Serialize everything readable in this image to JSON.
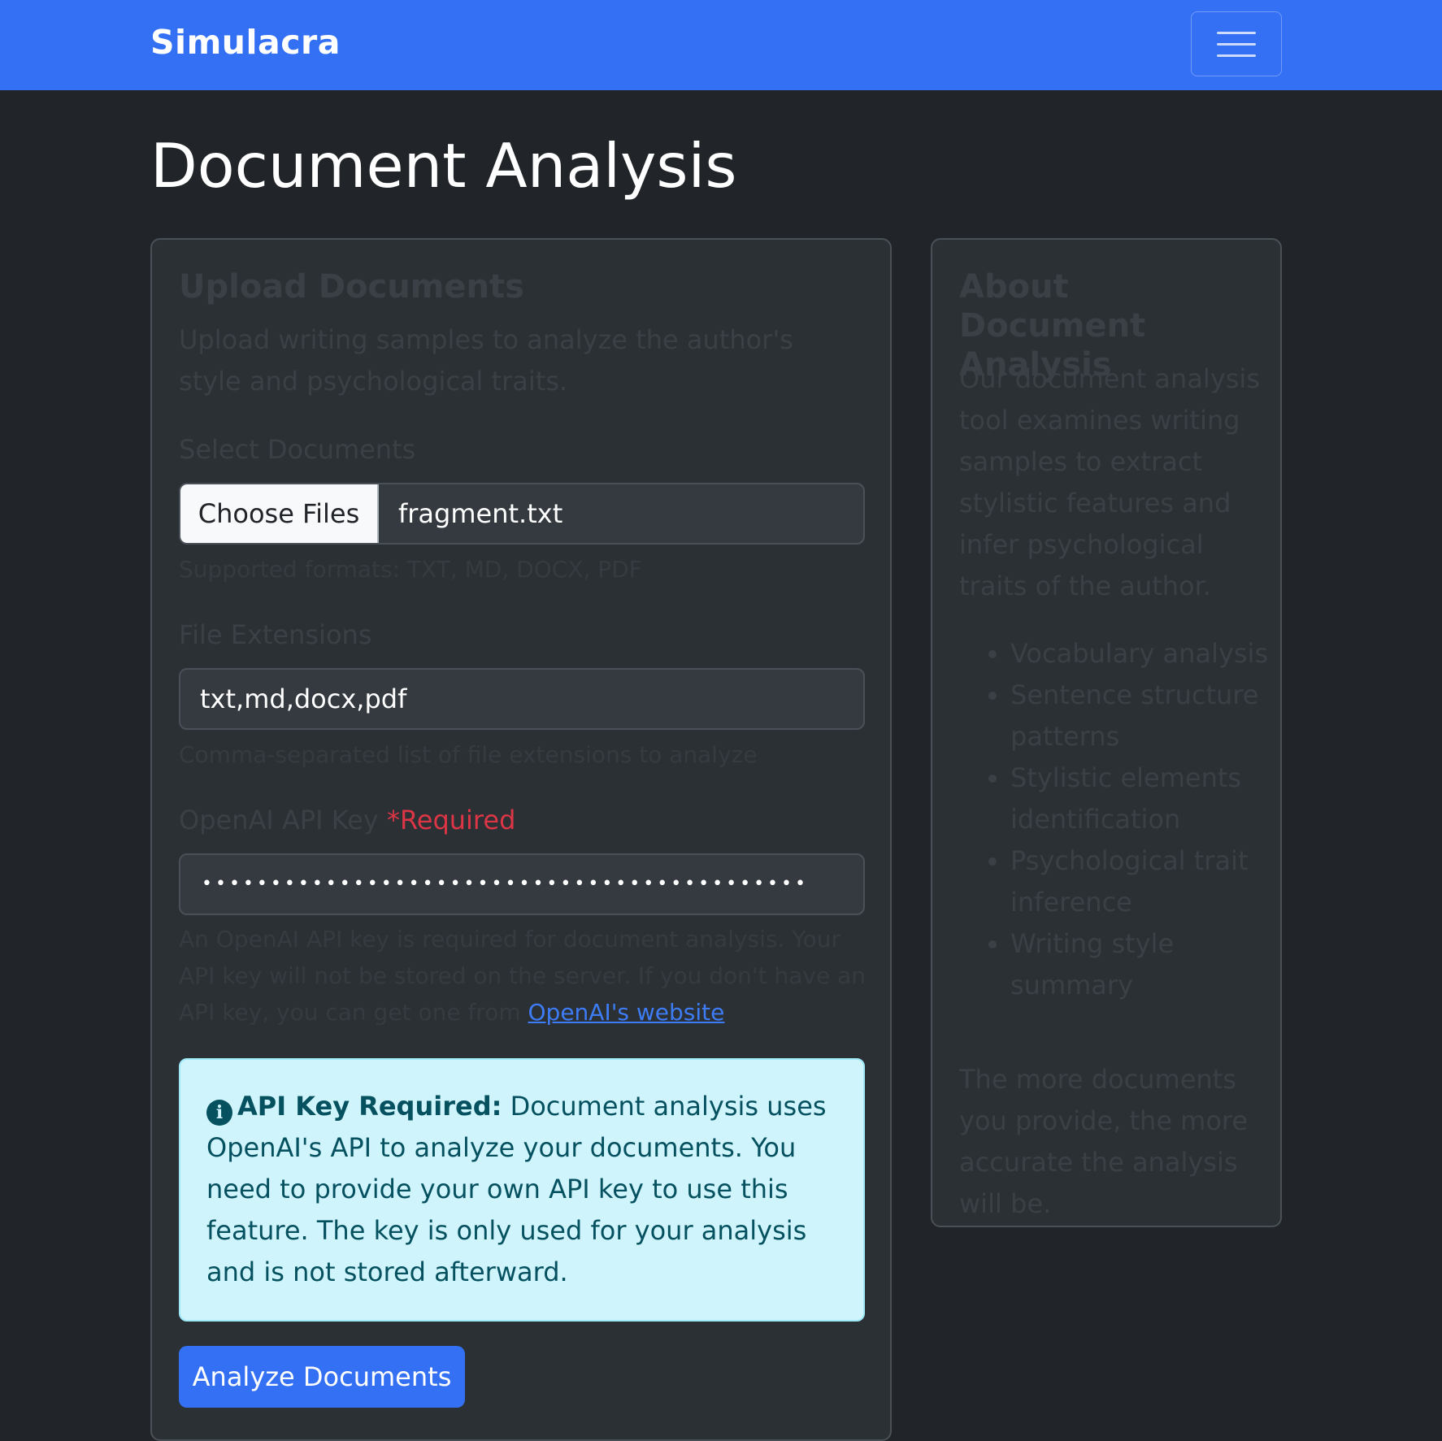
{
  "navbar": {
    "brand": "Simulacra",
    "menu_icon": "hamburger-menu-icon"
  },
  "page": {
    "title": "Document Analysis"
  },
  "upload_card": {
    "title": "Upload Documents",
    "description": "Upload writing samples to analyze the author's style and psychological traits.",
    "select_label": "Select Documents",
    "choose_button": "Choose Files",
    "selected_file": "fragment.txt",
    "formats_help": "Supported formats: TXT, MD, DOCX, PDF",
    "extensions_label": "File Extensions",
    "extensions_value": "txt,md,docx,pdf",
    "extensions_help": "Comma-separated list of file extensions to analyze",
    "api_key_label": "OpenAI API Key",
    "api_key_required": "*Required",
    "api_key_masked": "••••••••••••••••••••••••••••••••••••••••••••",
    "api_key_help": "An OpenAI API key is required for document analysis. Your API key will not be stored on the server. If you don't have an API key, you can get one from",
    "api_key_link": "OpenAI's website",
    "alert_icon": "info-circle-icon",
    "alert_title": "API Key Required:",
    "alert_text": "Document analysis uses OpenAI's API to analyze your documents. You need to provide your own API key to use this feature. The key is only used for your analysis and is not stored afterward.",
    "submit_button": "Analyze Documents"
  },
  "about_card": {
    "title": "About Document Analysis",
    "description": "Our document analysis tool examines writing samples to extract stylistic features and infer psychological traits of the author.",
    "features": [
      "Vocabulary analysis",
      "Sentence structure patterns",
      "Stylistic elements identification",
      "Psychological trait inference",
      "Writing style summary"
    ],
    "footer": "The more documents you provide, the more accurate the analysis will be."
  },
  "colors": {
    "navbar": "#3470f4",
    "background": "#212529",
    "card": "#2b3035",
    "alert_bg": "#cff4fc",
    "required": "#dc3545"
  }
}
